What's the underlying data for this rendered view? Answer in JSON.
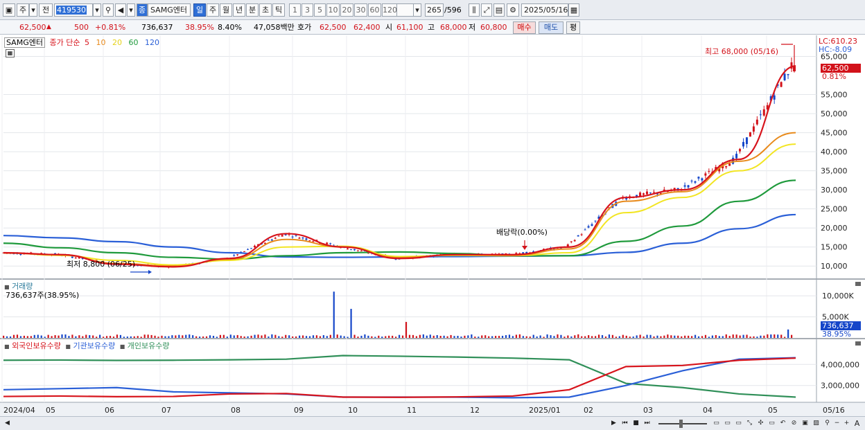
{
  "toolbar": {
    "market_label": "주",
    "prev_label": "전",
    "code": "419530",
    "name_badge": "종",
    "stock_name": "SAMG엔터",
    "periods": [
      "일",
      "주",
      "월",
      "년",
      "분",
      "초",
      "틱"
    ],
    "active_period": "일",
    "intervals": [
      "1",
      "3",
      "5",
      "10",
      "20",
      "30",
      "60",
      "120"
    ],
    "count_value": "265",
    "count_total": "/596",
    "date": "2025/05/16"
  },
  "quote": {
    "price": "62,500",
    "change": "500",
    "change_pct": "+0.81%",
    "volume": "736,637",
    "volume_ratio": "38.95%",
    "turnover": "8.40%",
    "amount": "47,058백만",
    "bid_label": "호가",
    "bid": "62,500",
    "ask": "62,400",
    "open_label": "시",
    "open": "61,100",
    "high_label": "고",
    "high": "68,000",
    "low_label": "저",
    "low": "60,800",
    "buy_label": "매수",
    "sell_label": "매도",
    "avg_label": "평"
  },
  "legend": {
    "stock": "SAMG엔터",
    "ma_label": "종가 단순",
    "ma5": "5",
    "ma10": "10",
    "ma20": "20",
    "ma60": "60",
    "ma120": "120"
  },
  "colors": {
    "ma5": "#d7141c",
    "ma10": "#e88a1b",
    "ma20": "#f2e523",
    "ma60": "#1f9a3c",
    "ma120": "#2a5fd7",
    "up": "#d2121a",
    "down": "#1546c9",
    "foreign": "#d7141c",
    "institution": "#2a5fd7",
    "individual": "#2f8f58"
  },
  "price_panel": {
    "lc": "LC:610.23",
    "hc": "HC:-8.09",
    "current_tag": "62,500",
    "current_pct": "0.81%",
    "high_annot": "최고 68,000 (05/16)",
    "low_annot": "최저 8,800 (06/25)",
    "dividend_annot": "배당락(0.00%)",
    "y_ticks": [
      "65,000",
      "55,000",
      "50,000",
      "45,000",
      "40,000",
      "35,000",
      "30,000",
      "25,000",
      "20,000",
      "15,000",
      "10,000"
    ]
  },
  "volume_panel": {
    "title": "거래량",
    "value": "736,637주(38.95%)",
    "y_ticks": [
      "10,000K",
      "5,000K"
    ],
    "current_tag": "736,637",
    "current_pct": "38.95%"
  },
  "holdings_panel": {
    "legend_foreign": "외국인보유수량",
    "legend_institution": "기관보유수량",
    "legend_individual": "개인보유수량",
    "y_ticks": [
      "4,000,000",
      "3,000,000"
    ]
  },
  "x_axis": {
    "labels": [
      "2024/04",
      "05",
      "06",
      "07",
      "08",
      "09",
      "10",
      "11",
      "12",
      "2025/01",
      "02",
      "03",
      "04",
      "05"
    ],
    "end_label": "05/16"
  },
  "chart_data": {
    "type": "line",
    "x": [
      "2024/04",
      "05",
      "06",
      "07",
      "08",
      "09",
      "10",
      "11",
      "12",
      "2025/01",
      "02",
      "03",
      "04",
      "05",
      "05/16"
    ],
    "series": [
      {
        "name": "5",
        "values": [
          13500,
          13000,
          10500,
          9800,
          12000,
          18500,
          15000,
          12000,
          13000,
          13000,
          15000,
          28000,
          30000,
          38000,
          62500
        ]
      },
      {
        "name": "10",
        "values": [
          13400,
          13000,
          10700,
          10000,
          11800,
          17000,
          15000,
          12200,
          13000,
          12800,
          14500,
          27000,
          29500,
          37500,
          45000
        ]
      },
      {
        "name": "20",
        "values": [
          13500,
          12800,
          11500,
          10300,
          11500,
          15000,
          15200,
          12500,
          12800,
          12700,
          13500,
          24000,
          28000,
          35000,
          42000
        ]
      },
      {
        "name": "60",
        "values": [
          16000,
          14800,
          13500,
          12300,
          11800,
          12700,
          13500,
          13700,
          13300,
          12700,
          12700,
          16500,
          20500,
          27000,
          32500
        ]
      },
      {
        "name": "120",
        "values": [
          18000,
          17400,
          16400,
          15000,
          13500,
          12400,
          12300,
          12400,
          12500,
          12600,
          12700,
          13600,
          16000,
          19800,
          23500
        ]
      }
    ],
    "high": {
      "value": 68000,
      "date": "05/16"
    },
    "low": {
      "value": 8800,
      "date": "06/25"
    },
    "ylim": [
      7500,
      68000
    ]
  }
}
